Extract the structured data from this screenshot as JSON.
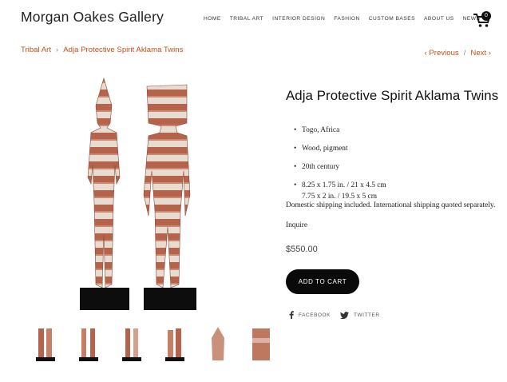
{
  "site": {
    "title": "Morgan Oakes Gallery"
  },
  "nav": [
    "HOME",
    "TRIBAL ART",
    "INTERIOR DESIGN",
    "FASHION",
    "CUSTOM BASES",
    "ABOUT US",
    "NEWS"
  ],
  "cart": {
    "count": "0",
    "icon": "cart-icon"
  },
  "breadcrumb": {
    "parent": "Tribal Art",
    "sep": "›",
    "current": "Adja Protective Spirit Aklama Twins"
  },
  "pager": {
    "previous": "‹ Previous",
    "sep": "/",
    "next": "Next ›"
  },
  "product": {
    "title": "Adja Protective Spirit Aklama Twins",
    "details": [
      "Togo, Africa",
      "Wood, pigment",
      "20th century"
    ],
    "dimensions": [
      "8.25 x 1.75 in. / 21 x 4.5 cm",
      "7.75 x 2 in. / 19.5 x 5 cm"
    ],
    "shipping": "Domestic shipping included.  International shipping quoted separately.",
    "inquire": "Inquire",
    "price": "$550.00",
    "add_to_cart": "ADD TO CART"
  },
  "share": {
    "facebook": "FACEBOOK",
    "twitter": "TWITTER"
  },
  "colors": {
    "accent": "#c2501b",
    "button": "#0a0a0a"
  }
}
